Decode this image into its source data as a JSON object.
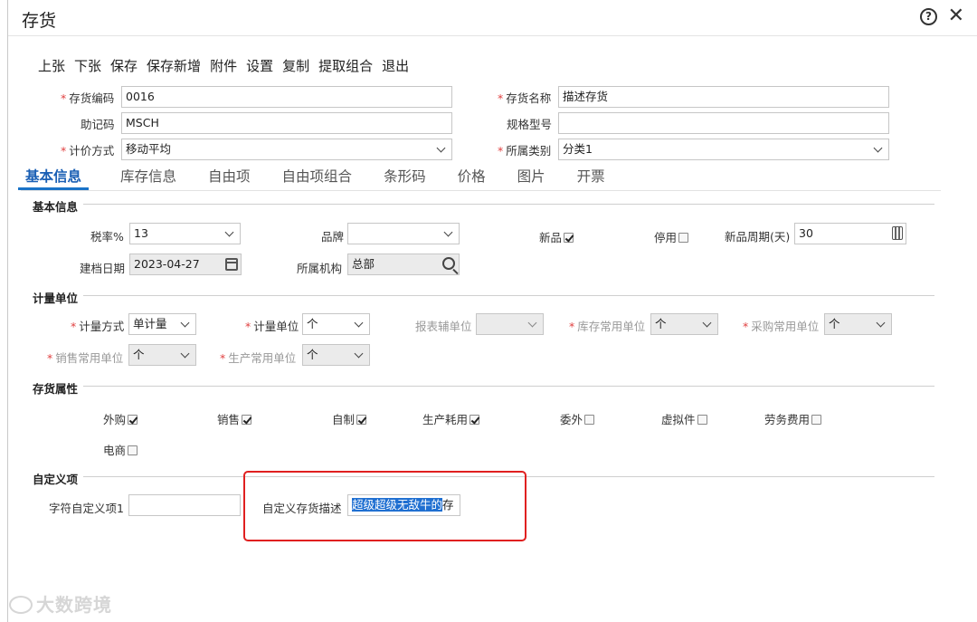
{
  "window": {
    "title": "存货"
  },
  "toolbar": [
    "上张",
    "下张",
    "保存",
    "保存新增",
    "附件",
    "设置",
    "复制",
    "提取组合",
    "退出"
  ],
  "header": {
    "code_label": "存货编码",
    "code_value": "0016",
    "name_label": "存货名称",
    "name_value": "描述存货",
    "mnemonic_label": "助记码",
    "mnemonic_value": "MSCH",
    "spec_label": "规格型号",
    "spec_value": "",
    "pricing_label": "计价方式",
    "pricing_value": "移动平均",
    "category_label": "所属类别",
    "category_value": "分类1"
  },
  "tabs": [
    "基本信息",
    "库存信息",
    "自由项",
    "自由项组合",
    "条形码",
    "价格",
    "图片",
    "开票"
  ],
  "basic": {
    "section_title": "基本信息",
    "tax_label": "税率%",
    "tax_value": "13",
    "brand_label": "品牌",
    "brand_value": "",
    "new_label": "新品",
    "new_checked": true,
    "disabled_label": "停用",
    "disabled_checked": false,
    "cycle_label": "新品周期(天)",
    "cycle_value": "30",
    "date_label": "建档日期",
    "date_value": "2023-04-27",
    "org_label": "所属机构",
    "org_value": "总部"
  },
  "units": {
    "section_title": "计量单位",
    "method_label": "计量方式",
    "method_value": "单计量",
    "unit_label": "计量单位",
    "unit_value": "个",
    "report_label": "报表辅单位",
    "report_value": "",
    "stock_label": "库存常用单位",
    "stock_value": "个",
    "purchase_label": "采购常用单位",
    "purchase_value": "个",
    "sales_label": "销售常用单位",
    "sales_value": "个",
    "production_label": "生产常用单位",
    "production_value": "个"
  },
  "attrs": {
    "section_title": "存货属性",
    "items": [
      {
        "label": "外购",
        "checked": true
      },
      {
        "label": "销售",
        "checked": true
      },
      {
        "label": "自制",
        "checked": true
      },
      {
        "label": "生产耗用",
        "checked": true
      },
      {
        "label": "委外",
        "checked": false
      },
      {
        "label": "虚拟件",
        "checked": false
      },
      {
        "label": "劳务费用",
        "checked": false
      },
      {
        "label": "电商",
        "checked": false
      }
    ]
  },
  "custom": {
    "section_title": "自定义项",
    "char1_label": "字符自定义项1",
    "char1_value": "",
    "desc_label": "自定义存货描述",
    "desc_selected": "超级超级无敌牛的",
    "desc_rest": "存"
  },
  "colors": {
    "accent": "#1a73c8",
    "highlight": "#e02020",
    "selection": "#1f6fd1"
  },
  "watermark": "大数跨境"
}
